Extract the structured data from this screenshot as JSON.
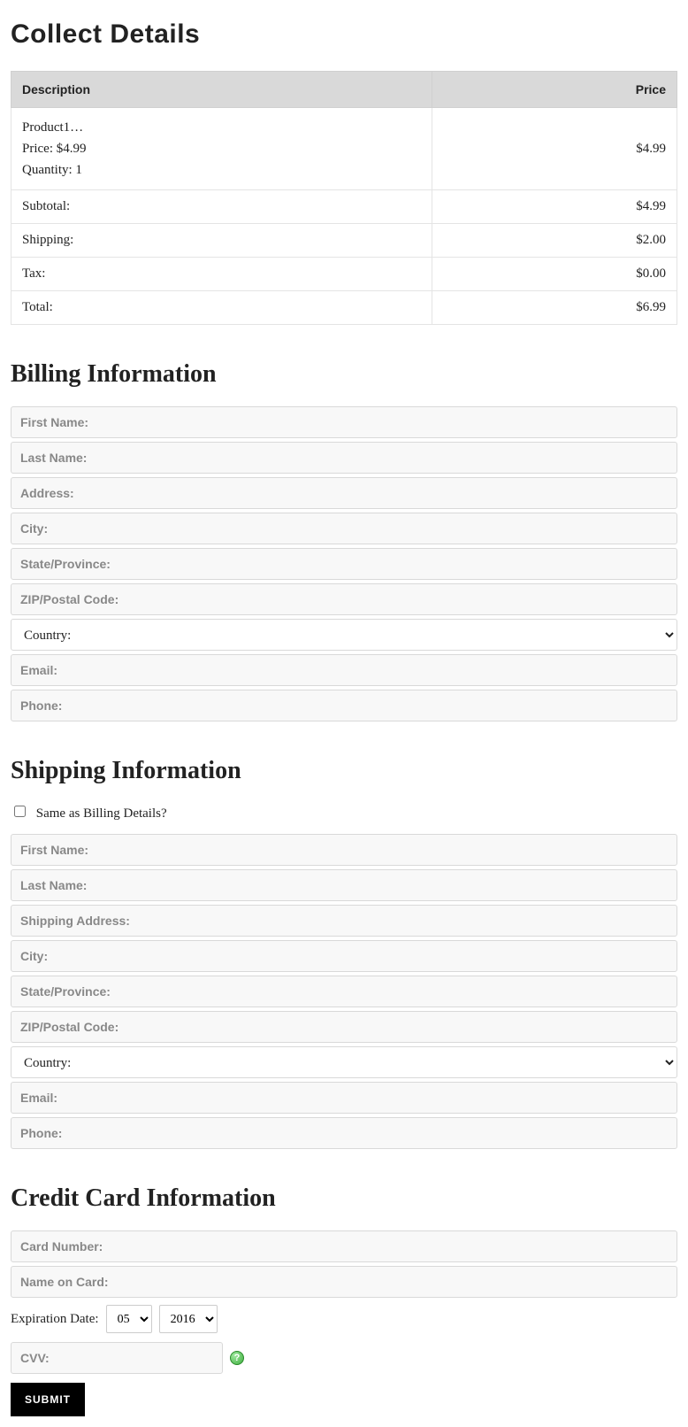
{
  "page": {
    "title": "Collect Details"
  },
  "summary": {
    "headers": {
      "description": "Description",
      "price": "Price"
    },
    "product": {
      "name": "Product1…",
      "price_label": "Price: $4.99",
      "quantity_label": "Quantity: 1",
      "line_price": "$4.99"
    },
    "rows": [
      {
        "label": "Subtotal:",
        "value": "$4.99"
      },
      {
        "label": "Shipping:",
        "value": "$2.00"
      },
      {
        "label": "Tax:",
        "value": "$0.00"
      },
      {
        "label": "Total:",
        "value": "$6.99"
      }
    ]
  },
  "billing": {
    "heading": "Billing Information",
    "placeholders": {
      "first_name": "First Name:",
      "last_name": "Last Name:",
      "address": "Address:",
      "city": "City:",
      "state": "State/Province:",
      "zip": "ZIP/Postal Code:",
      "email": "Email:",
      "phone": "Phone:"
    },
    "country_option": "Country:"
  },
  "shipping": {
    "heading": "Shipping Information",
    "same_as_billing_label": "Same as Billing Details?",
    "placeholders": {
      "first_name": "First Name:",
      "last_name": "Last Name:",
      "address": "Shipping Address:",
      "city": "City:",
      "state": "State/Province:",
      "zip": "ZIP/Postal Code:",
      "email": "Email:",
      "phone": "Phone:"
    },
    "country_option": "Country:"
  },
  "card": {
    "heading": "Credit Card Information",
    "placeholders": {
      "number": "Card Number:",
      "name": "Name on Card:",
      "cvv": "CVV:"
    },
    "expiration_label": "Expiration Date:",
    "month_selected": "05",
    "year_selected": "2016",
    "help_glyph": "?"
  },
  "submit_label": "SUBMIT"
}
